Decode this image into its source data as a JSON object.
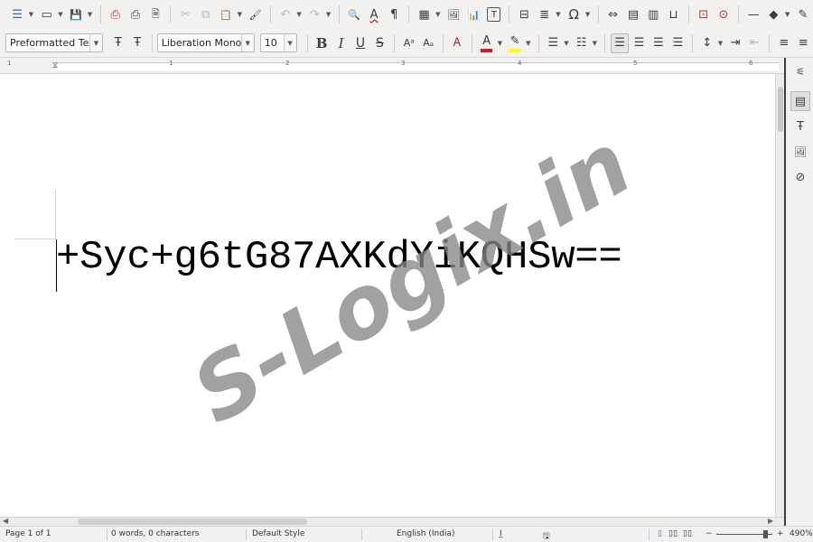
{
  "toolbar_standard": {
    "icons": [
      "menu-icon",
      "open-icon",
      "save-icon",
      "export-pdf-icon",
      "print-icon",
      "print-preview-icon",
      "cut-icon",
      "copy-icon",
      "paste-icon",
      "clone-icon",
      "undo-icon",
      "redo-icon",
      "find-replace-icon",
      "spelling-icon",
      "formatting-marks-icon",
      "table-icon",
      "image-icon",
      "chart-icon",
      "textbox-icon",
      "page-break-icon",
      "field-icon",
      "special-char-icon",
      "hyperlink-icon",
      "footnote-icon",
      "endnote-icon",
      "bookmark-icon",
      "comment-icon",
      "track-changes-icon",
      "line-icon",
      "shapes-icon",
      "draw-icon"
    ],
    "glyphs": {
      "menu": "☰",
      "open": "▭",
      "save": "💾",
      "export_pdf": "⎙",
      "print": "⎙",
      "preview": "🗎",
      "cut": "✂",
      "copy": "⧉",
      "paste": "📋",
      "clone": "🖌",
      "undo": "↶",
      "redo": "↷",
      "find": "🔍",
      "spell": "A",
      "pilcrow": "¶",
      "table": "▦",
      "image": "🖼",
      "chart": "📊",
      "textbox": "T",
      "pagebreak": "⊟",
      "field": "≣",
      "special": "Ω",
      "link": "⇔",
      "footnote": "▤",
      "endnote": "▥",
      "bookmark": "⊔",
      "comment": "⊡",
      "track": "⊙",
      "line": "—",
      "shape": "◆",
      "draw": "✎"
    }
  },
  "toolbar_formatting": {
    "paragraph_style": "Preformatted Text",
    "font_name": "Liberation Mono",
    "font_size": "10",
    "glyphs": {
      "update_style": "Ŧ",
      "new_style": "Ŧ",
      "bold": "B",
      "italic": "I",
      "underline": "U",
      "strike": "S",
      "superscript": "Aᵃ",
      "subscript": "Aₐ",
      "clear": "Ꭺ",
      "font_color": "A",
      "highlight": "✎",
      "bullets": "☰",
      "numbering": "☷",
      "align_left": "☰",
      "align_center": "☰",
      "align_right": "☰",
      "justify": "☰",
      "line_spacing": "↕",
      "indent_inc": "⇥",
      "indent_dec": "⇤",
      "para_above": "≡",
      "para_below": "≡"
    },
    "colors": {
      "font_color": "#c9211e",
      "highlight": "#ffff00"
    }
  },
  "ruler": {
    "labels": [
      "1",
      "1",
      "2",
      "3",
      "4",
      "5",
      "6"
    ]
  },
  "document": {
    "text": "+Syc+g6tG87AXKdYiKQHSw==",
    "watermark": "S-Logix.in"
  },
  "sidebar": {
    "glyphs": {
      "properties": "⚟",
      "styles": "▤",
      "gallery": "🖼",
      "navigator": "⊘",
      "page": "Ŧ"
    }
  },
  "statusbar": {
    "page": "Page 1 of 1",
    "words": "0 words, 0 characters",
    "page_style": "Default Style",
    "language": "English (India)",
    "zoom": "490%",
    "glyphs": {
      "insert_mode": "I̲",
      "save_state": "🖫",
      "view_single": "▯",
      "view_multi": "▯▯",
      "view_book": "▯▯",
      "zoom_out": "−",
      "zoom_in": "+"
    }
  }
}
